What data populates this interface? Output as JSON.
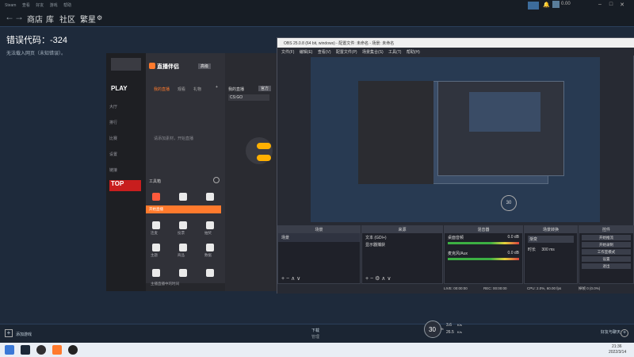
{
  "steam": {
    "menu": [
      "Steam",
      "查看",
      "好友",
      "游戏",
      "帮助"
    ],
    "nav": [
      "商店",
      "库",
      "社区",
      "繁星"
    ],
    "status": "0.00",
    "error_title": "错误代码：-324",
    "error_sub": "无法载入网页（未知错误）。",
    "bottom_left": "添加游戏",
    "bottom_center_label": "下载",
    "bottom_center_sub": "管理",
    "bottom_right": "好友与聊天",
    "speed_badge": "30",
    "speed_badge_unit": "%",
    "speed_up": "3.6",
    "speed_down": "26.5",
    "speed_unit": "K/s"
  },
  "live": {
    "left_items": [
      "大厅",
      "PLAY",
      "排行",
      "比赛",
      "设置",
      "链接"
    ],
    "logo": "直播伴侣",
    "badge": "高级",
    "tabs": [
      "我的直播",
      "观看",
      "礼物",
      "+"
    ],
    "stream_title": "我的直播",
    "game": "CS:GO",
    "empty_text": "请添加素材，开始直播",
    "tools_title": "工具箱",
    "orange_bar": "开始直播",
    "tools": [
      "弹幕",
      "礼物",
      "场控",
      "连麦",
      "投票",
      "抽奖",
      "主题",
      "商品",
      "数据",
      "PK",
      "福袋",
      "设置"
    ],
    "footer": "主播直播中的时间",
    "topbar_label": "官方"
  },
  "obs": {
    "title": "OBS 25.0.8 (64 bit, windows) - 配置文件: 未命名 - 场景: 未命名",
    "menu": [
      "文件(F)",
      "编辑(E)",
      "查看(V)",
      "配置文件(P)",
      "场景集合(S)",
      "工具(T)",
      "帮助(H)"
    ],
    "docks": {
      "scenes": {
        "title": "场景",
        "items": [
          "场景"
        ]
      },
      "sources": {
        "title": "来源",
        "items": [
          "文本 (GDI+)",
          "显示器捕获"
        ]
      },
      "mixer": {
        "title": "混音器",
        "tracks": [
          {
            "name": "桌面音频",
            "db": "0.0 dB"
          },
          {
            "name": "麦克风/Aux",
            "db": "0.0 dB"
          }
        ]
      },
      "transitions": {
        "title": "场景转换",
        "type": "渐变",
        "duration_label": "时长",
        "duration": "300 ms"
      },
      "controls": {
        "title": "控件",
        "buttons": [
          "开始推流",
          "开始录制",
          "工作室模式",
          "设置",
          "退出"
        ]
      }
    },
    "status": {
      "live": "LIVE: 00:00:00",
      "rec": "REC: 00:00:00",
      "cpu": "CPU: 2.0%, 60.00 fps",
      "dropped": "掉帧 0 (0.0%)"
    }
  },
  "taskbar": {
    "clock_time": "21:36",
    "clock_date": "2022/3/14",
    "icons": [
      "windows",
      "steam",
      "obs",
      "live-companion",
      "obs-app"
    ]
  },
  "colors": {
    "steam_bg": "#1e2a3b",
    "accent_orange": "#ff7a2d",
    "obs_bg": "#272a33"
  }
}
